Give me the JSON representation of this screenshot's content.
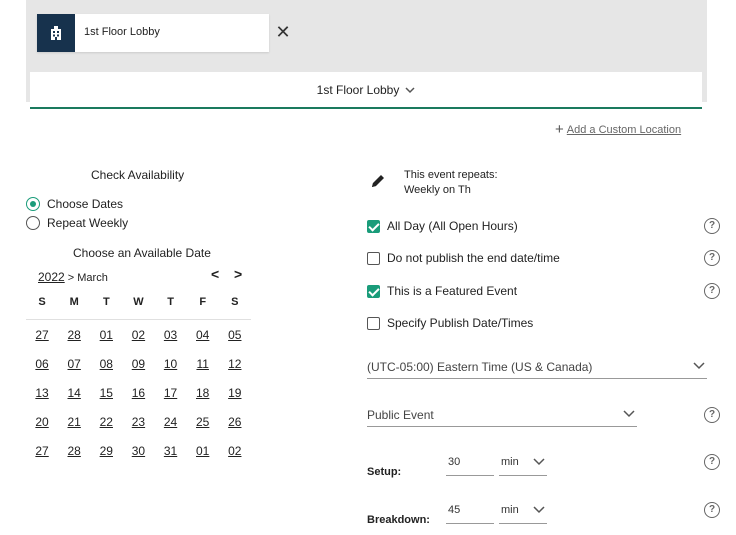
{
  "location_chip": {
    "label": "1st Floor Lobby",
    "icon": "building-icon",
    "close": "✕"
  },
  "location_bar": {
    "label": "1st Floor Lobby"
  },
  "add_location": {
    "label": "Add a Custom Location"
  },
  "availability": {
    "title": "Check Availability",
    "options": [
      {
        "label": "Choose Dates",
        "selected": true
      },
      {
        "label": "Repeat Weekly",
        "selected": false
      }
    ],
    "date_title": "Choose an Available Date"
  },
  "calendar": {
    "year": "2022",
    "month": "> March",
    "prev": "<",
    "next": ">",
    "weekdays": [
      "S",
      "M",
      "T",
      "W",
      "T",
      "F",
      "S"
    ],
    "weeks": [
      [
        "27",
        "28",
        "01",
        "02",
        "03",
        "04",
        "05"
      ],
      [
        "06",
        "07",
        "08",
        "09",
        "10",
        "11",
        "12"
      ],
      [
        "13",
        "14",
        "15",
        "16",
        "17",
        "18",
        "19"
      ],
      [
        "20",
        "21",
        "22",
        "23",
        "24",
        "25",
        "26"
      ],
      [
        "27",
        "28",
        "29",
        "30",
        "31",
        "01",
        "02"
      ]
    ]
  },
  "repeat": {
    "line1": "This event repeats:",
    "line2": "Weekly on Th"
  },
  "options": [
    {
      "label": "All Day (All Open Hours)",
      "checked": true,
      "help": "?"
    },
    {
      "label": "Do not publish the end date/time",
      "checked": false,
      "help": "?"
    },
    {
      "label": "This is a Featured Event",
      "checked": true,
      "help": "?"
    },
    {
      "label": "Specify Publish Date/Times",
      "checked": false
    }
  ],
  "timezone": {
    "value": "(UTC-05:00) Eastern Time (US & Canada)"
  },
  "visibility": {
    "value": "Public Event",
    "help": "?"
  },
  "setup": {
    "label": "Setup:",
    "value": "30",
    "unit": "min",
    "help": "?"
  },
  "breakdown": {
    "label": "Breakdown:",
    "value": "45",
    "unit": "min",
    "help": "?"
  },
  "colors": {
    "accent": "#1a9c7a",
    "chip_bg": "#17324d",
    "band_bg": "#e6e6e6",
    "underline": "#1a7a5e"
  }
}
